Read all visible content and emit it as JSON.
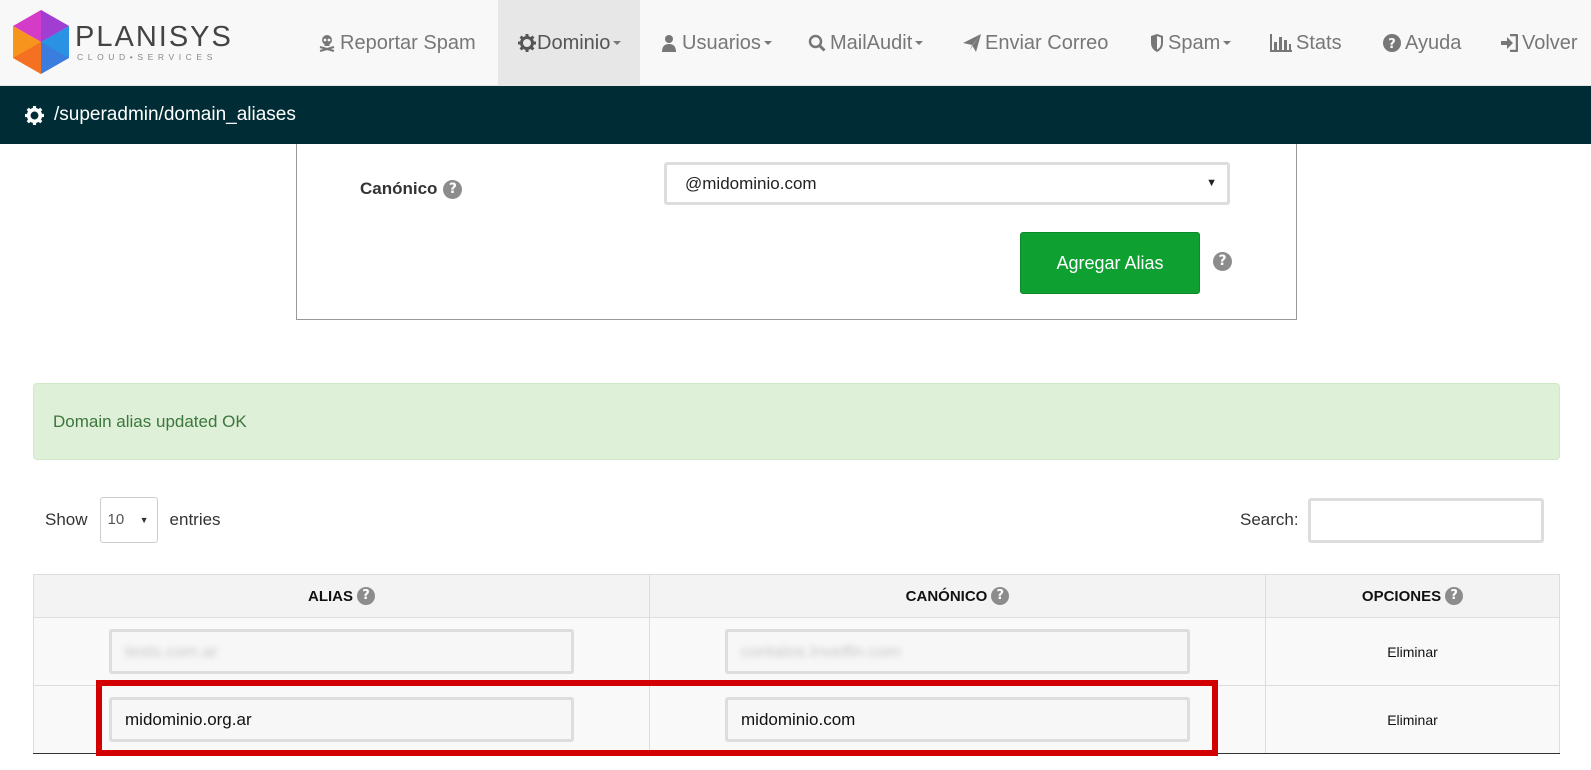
{
  "brand": {
    "name": "PLANISYS",
    "tagline": "CLOUD•SERVICES"
  },
  "nav": [
    {
      "label": "Reportar Spam",
      "icon": "skull-crossbones-icon",
      "dropdown": false
    },
    {
      "label": "Dominio",
      "icon": "gear-icon",
      "dropdown": true,
      "active": true
    },
    {
      "label": "Usuarios",
      "icon": "user-icon",
      "dropdown": true
    },
    {
      "label": "MailAudit",
      "icon": "search-icon",
      "dropdown": true
    },
    {
      "label": "Enviar Correo",
      "icon": "paper-plane-icon",
      "dropdown": false
    },
    {
      "label": "Spam",
      "icon": "shield-icon",
      "dropdown": true
    },
    {
      "label": "Stats",
      "icon": "bar-chart-icon",
      "dropdown": false
    },
    {
      "label": "Ayuda",
      "icon": "question-circle-icon",
      "dropdown": false
    },
    {
      "label": "Volver",
      "icon": "sign-in-icon",
      "dropdown": false
    }
  ],
  "path": "/superadmin/domain_aliases",
  "form": {
    "canonico_label": "Canónico",
    "canonico_value": "@midominio.com",
    "add_button": "Agregar Alias"
  },
  "alert": "Domain alias updated OK",
  "table_controls": {
    "show_label": "Show",
    "entries_value": "10",
    "entries_label": "entries",
    "search_label": "Search:"
  },
  "table": {
    "headers": [
      "ALIAS",
      "CANÓNICO",
      "OPCIONES"
    ],
    "rows": [
      {
        "alias": "tests.com.ar",
        "canonico": "contatos.Invelfin.com",
        "option": "Eliminar",
        "blurred": true
      },
      {
        "alias": "midominio.org.ar",
        "canonico": "midominio.com",
        "option": "Eliminar",
        "blurred": false
      }
    ]
  },
  "colors": {
    "pathbar": "#002d35",
    "button": "#0ea031",
    "alert_bg": "#dff0d8",
    "alert_text": "#3c763d",
    "highlight": "#d20000"
  }
}
